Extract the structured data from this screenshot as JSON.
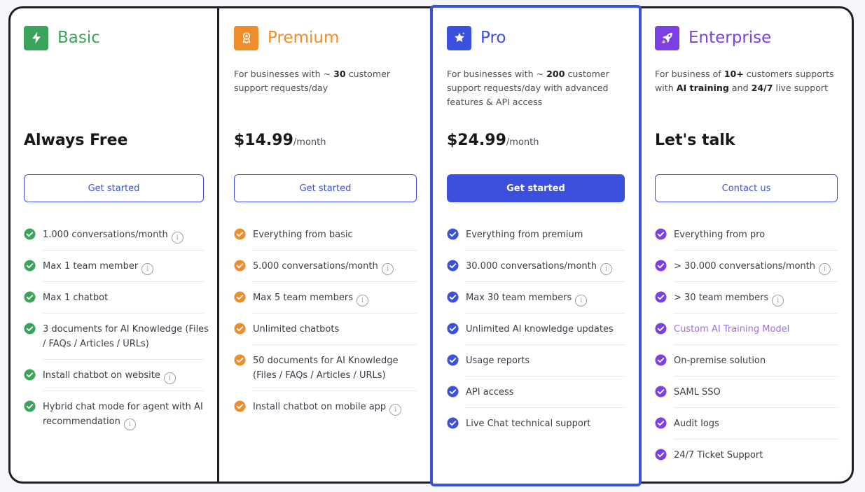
{
  "plans": [
    {
      "name": "Basic",
      "icon": "lightning-icon",
      "accent": "#3aa55a",
      "icon_bg": "#3aa55a",
      "description": [],
      "price": "Always Free",
      "price_unit": "",
      "cta": "Get started",
      "cta_filled": false,
      "features": [
        {
          "text": "1.000 conversations/month",
          "info": true
        },
        {
          "text": "Max 1 team member",
          "info": true
        },
        {
          "text": "Max 1 chatbot",
          "info": false
        },
        {
          "lines": [
            "3 documents for AI Knowledge (Files",
            "/ FAQs / Articles / URLs)"
          ],
          "info": false
        },
        {
          "text": "Install chatbot on website",
          "info": true
        },
        {
          "lines": [
            "Hybrid chat mode for agent with AI",
            "recommendation"
          ],
          "info": true
        }
      ]
    },
    {
      "name": "Premium",
      "icon": "badge-icon",
      "accent": "#f08c2a",
      "icon_bg": "#f08c2a",
      "description": [
        [
          {
            "t": "For businesses with ~ "
          },
          {
            "t": "30",
            "b": true
          },
          {
            "t": " customer"
          }
        ],
        [
          {
            "t": "support requests/day"
          }
        ]
      ],
      "price": "$14.99",
      "price_unit": "/month",
      "cta": "Get started",
      "cta_filled": false,
      "features": [
        {
          "text": "Everything from basic",
          "info": false
        },
        {
          "text": "5.000 conversations/month",
          "info": true
        },
        {
          "text": "Max 5 team members",
          "info": true
        },
        {
          "text": "Unlimited chatbots",
          "info": false
        },
        {
          "lines": [
            "50 documents for AI Knowledge",
            "(Files / FAQs / Articles / URLs)"
          ],
          "info": false
        },
        {
          "text": "Install chatbot on mobile app",
          "info": true
        }
      ]
    },
    {
      "name": "Pro",
      "icon": "star-icon",
      "accent": "#3b51de",
      "icon_bg": "#3b51de",
      "description": [
        [
          {
            "t": "For businesses with ~ "
          },
          {
            "t": "200",
            "b": true
          },
          {
            "t": " customer"
          }
        ],
        [
          {
            "t": "support requests/day with advanced"
          }
        ],
        [
          {
            "t": "features & API access"
          }
        ]
      ],
      "price": "$24.99",
      "price_unit": "/month",
      "cta": "Get started",
      "cta_filled": true,
      "features": [
        {
          "text": "Everything from premium",
          "info": false
        },
        {
          "text": "30.000 conversations/month",
          "info": true
        },
        {
          "text": "Max 30 team members",
          "info": true
        },
        {
          "text": "Unlimited AI knowledge updates",
          "info": false
        },
        {
          "text": "Usage reports",
          "info": false
        },
        {
          "text": "API access",
          "info": false
        },
        {
          "text": "Live Chat technical support",
          "info": false
        }
      ]
    },
    {
      "name": "Enterprise",
      "icon": "rocket-icon",
      "accent": "#7b3fe4",
      "icon_bg": "#7b3fe4",
      "description": [
        [
          {
            "t": "For business of "
          },
          {
            "t": "10+",
            "b": true
          },
          {
            "t": " customers supports"
          }
        ],
        [
          {
            "t": "with "
          },
          {
            "t": "AI training",
            "b": true
          },
          {
            "t": " and "
          },
          {
            "t": "24/7",
            "b": true
          },
          {
            "t": " live support"
          }
        ]
      ],
      "price": "Let's talk",
      "price_unit": "",
      "cta": "Contact us",
      "cta_filled": false,
      "features": [
        {
          "text": "Everything from pro",
          "info": false
        },
        {
          "text": "> 30.000 conversations/month",
          "info": true
        },
        {
          "text": "> 30 team members",
          "info": true
        },
        {
          "text": "Custom AI Training Model",
          "info": false,
          "highlight": true
        },
        {
          "text": "On-premise solution",
          "info": false
        },
        {
          "text": "SAML SSO",
          "info": false
        },
        {
          "text": "Audit logs",
          "info": false
        },
        {
          "text": "24/7 Ticket Support",
          "info": false
        }
      ]
    }
  ],
  "info_glyph": "i",
  "highlight_color": "#a56ae8"
}
